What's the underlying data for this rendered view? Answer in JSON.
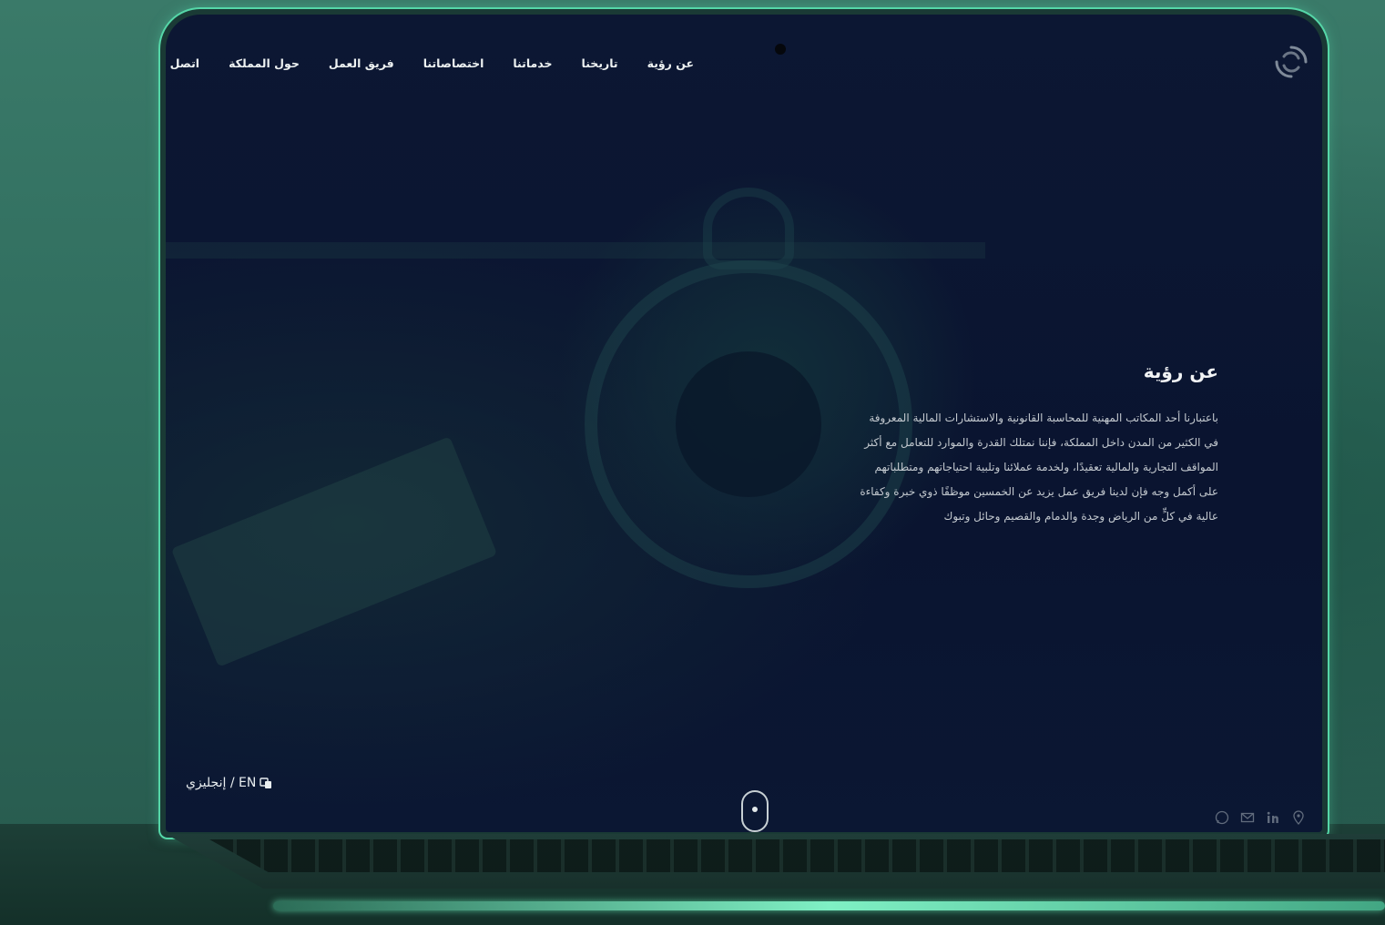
{
  "nav": {
    "items": [
      "عن رؤية",
      "تاريخنا",
      "خدماتنا",
      "اختصاصاتنا",
      "فريق العمل",
      "حول المملكة",
      "اتصل بنا"
    ]
  },
  "hero": {
    "title": "عن رؤية",
    "lines": [
      "باعتبارنا أحد المكاتب المهنية للمحاسبة القانونية والاستشارات المالية المعروفة",
      "في الكثير من المدن داخل المملكة، فإننا نمتلك القدرة والموارد للتعامل مع أكثر",
      "المواقف التجارية والمالية تعقيدًا، ولخدمة عملائنا وتلبية احتياجاتهم ومتطلباتهم",
      "على أكمل وجه فإن لدينا فريق عمل يزيد عن الخمسين موظفًا ذوي خبرة وكفاءة",
      "عالية في كلٍّ من الرياض وجدة والدمام والقصيم وحائل وتبوك"
    ]
  },
  "language": {
    "label": "EN / إنجليزي"
  },
  "social": {
    "icons": [
      "whatsapp-icon",
      "mail-icon",
      "linkedin-icon",
      "location-icon"
    ]
  },
  "colors": {
    "accent": "#55d7a8",
    "screen_bg": "#0a1430",
    "background": "#2f6c5d"
  }
}
